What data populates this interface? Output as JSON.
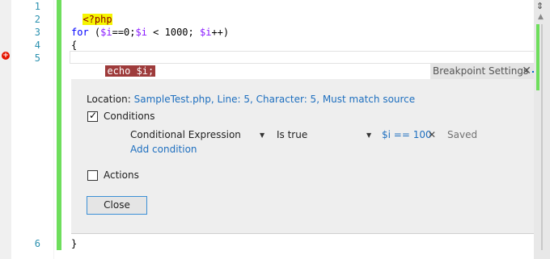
{
  "editor": {
    "line_numbers": [
      "1",
      "2",
      "3",
      "4",
      "5",
      "6"
    ],
    "lines": {
      "l1_tag": "<?php",
      "l3_for": "for",
      "l3_open": " (",
      "l3_var1": "$i",
      "l3_mid": "==0;",
      "l3_var2": "$i",
      "l3_cond": " < 1000; ",
      "l3_var3": "$i",
      "l3_end": "++)",
      "l4": "{",
      "l5": "echo $i;",
      "l6": "}"
    }
  },
  "breakpoint_settings": {
    "title": "Breakpoint Settings",
    "close_glyph": "✕",
    "location_label": "Location:",
    "location_value": "SampleTest.php, Line: 5, Character: 5, Must match source",
    "conditions_label": "Conditions",
    "conditions_checked": true,
    "condition_type": "Conditional Expression",
    "condition_mode": "Is true",
    "condition_expression": "$i == 100",
    "remove_glyph": "✕",
    "saved_label": "Saved",
    "add_condition": "Add condition",
    "actions_label": "Actions",
    "actions_checked": false,
    "close_button": "Close"
  },
  "scrollbar": {
    "split_glyph": "⇕",
    "up_glyph": "▲"
  },
  "colors": {
    "change_bar": "#6ede5c",
    "breakpoint": "#e51400",
    "breakpoint_line": "#9e3b3b",
    "link": "#1e6fbf",
    "php_tag_bg": "#f5f500"
  }
}
